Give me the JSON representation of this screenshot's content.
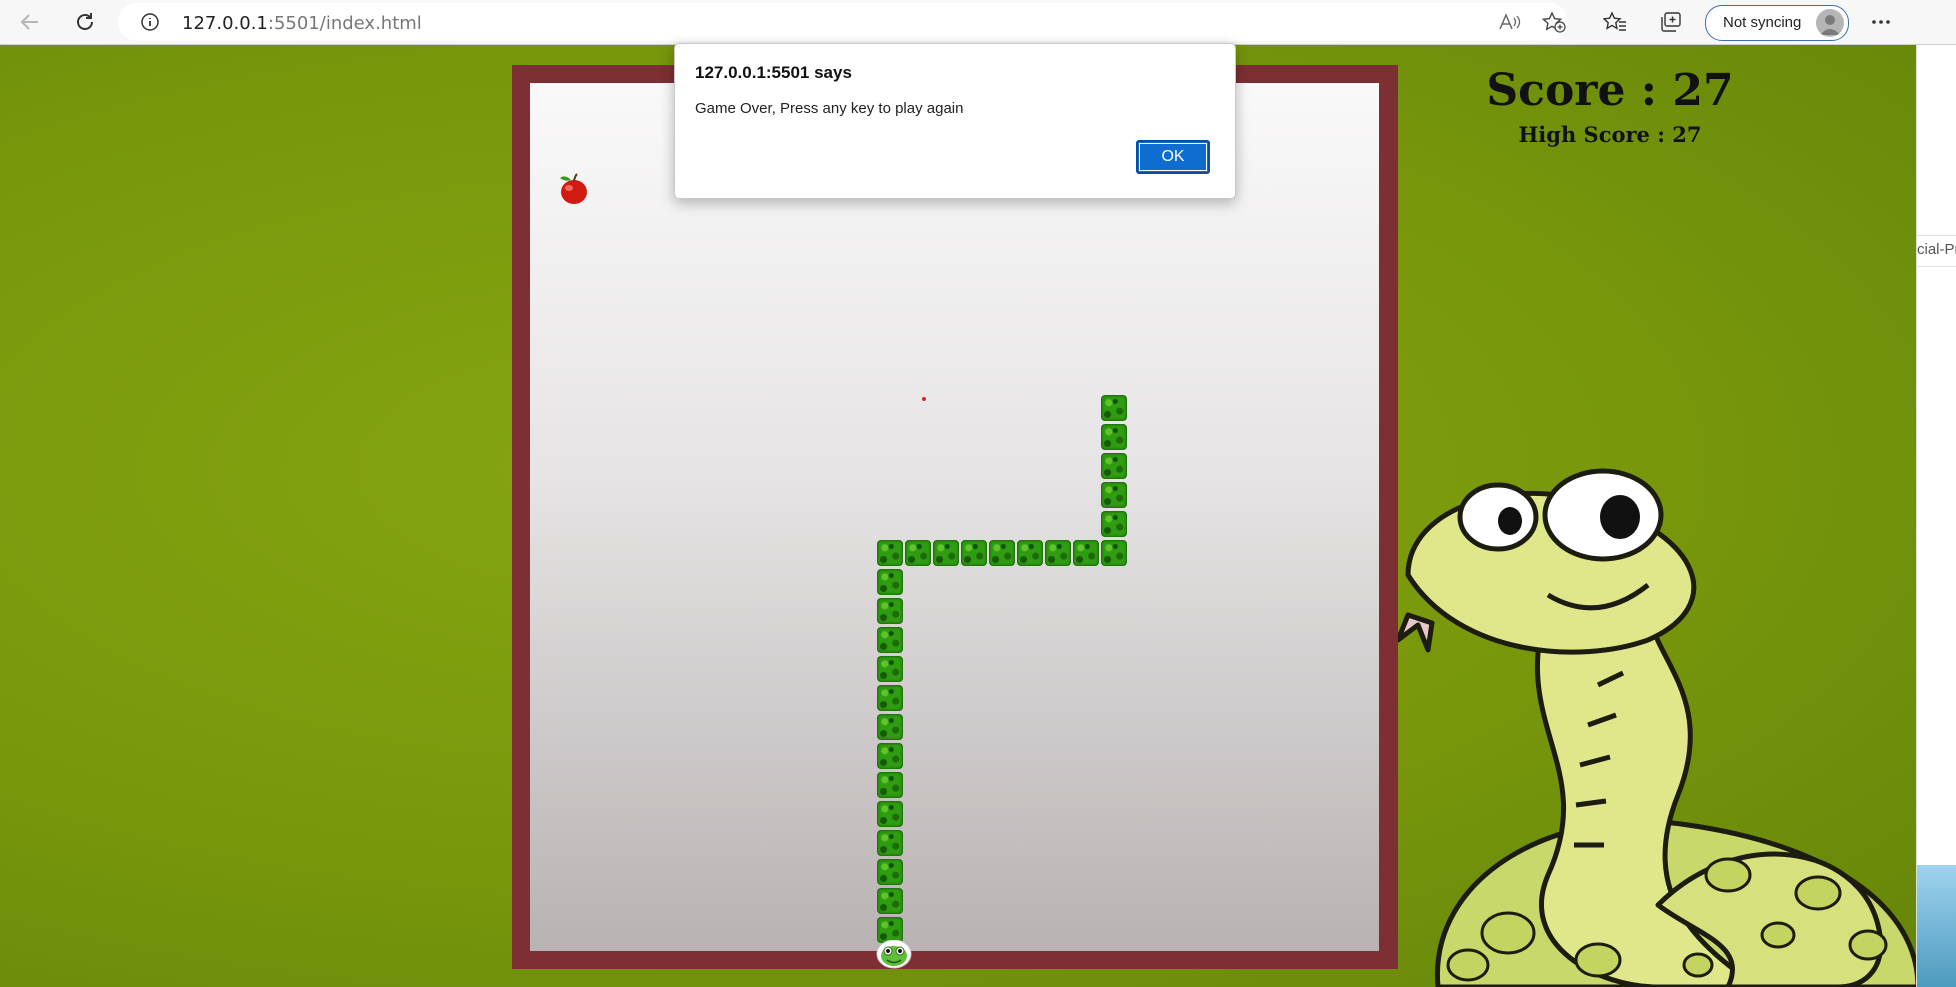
{
  "browser": {
    "url_host": "127.0.0.1",
    "url_rest": ":5501/index.html",
    "sync_label": "Not syncing",
    "icons": [
      "back-icon",
      "refresh-icon",
      "site-info-icon",
      "read-aloud-icon",
      "add-favorite-icon",
      "favorites-icon",
      "collections-icon",
      "more-icon"
    ]
  },
  "game": {
    "score_text": "Score : 27",
    "high_score_text": "High Score : 27",
    "score": 27,
    "high_score": 27,
    "colors": {
      "background": "#7a9a0c",
      "frame": "#7d2f33",
      "snake": "#2f9d12"
    }
  },
  "dialog": {
    "title": "127.0.0.1:5501 says",
    "message": "Game Over, Press any key to play again",
    "ok_label": "OK"
  },
  "side_strip": {
    "text": "cial-Pr"
  }
}
